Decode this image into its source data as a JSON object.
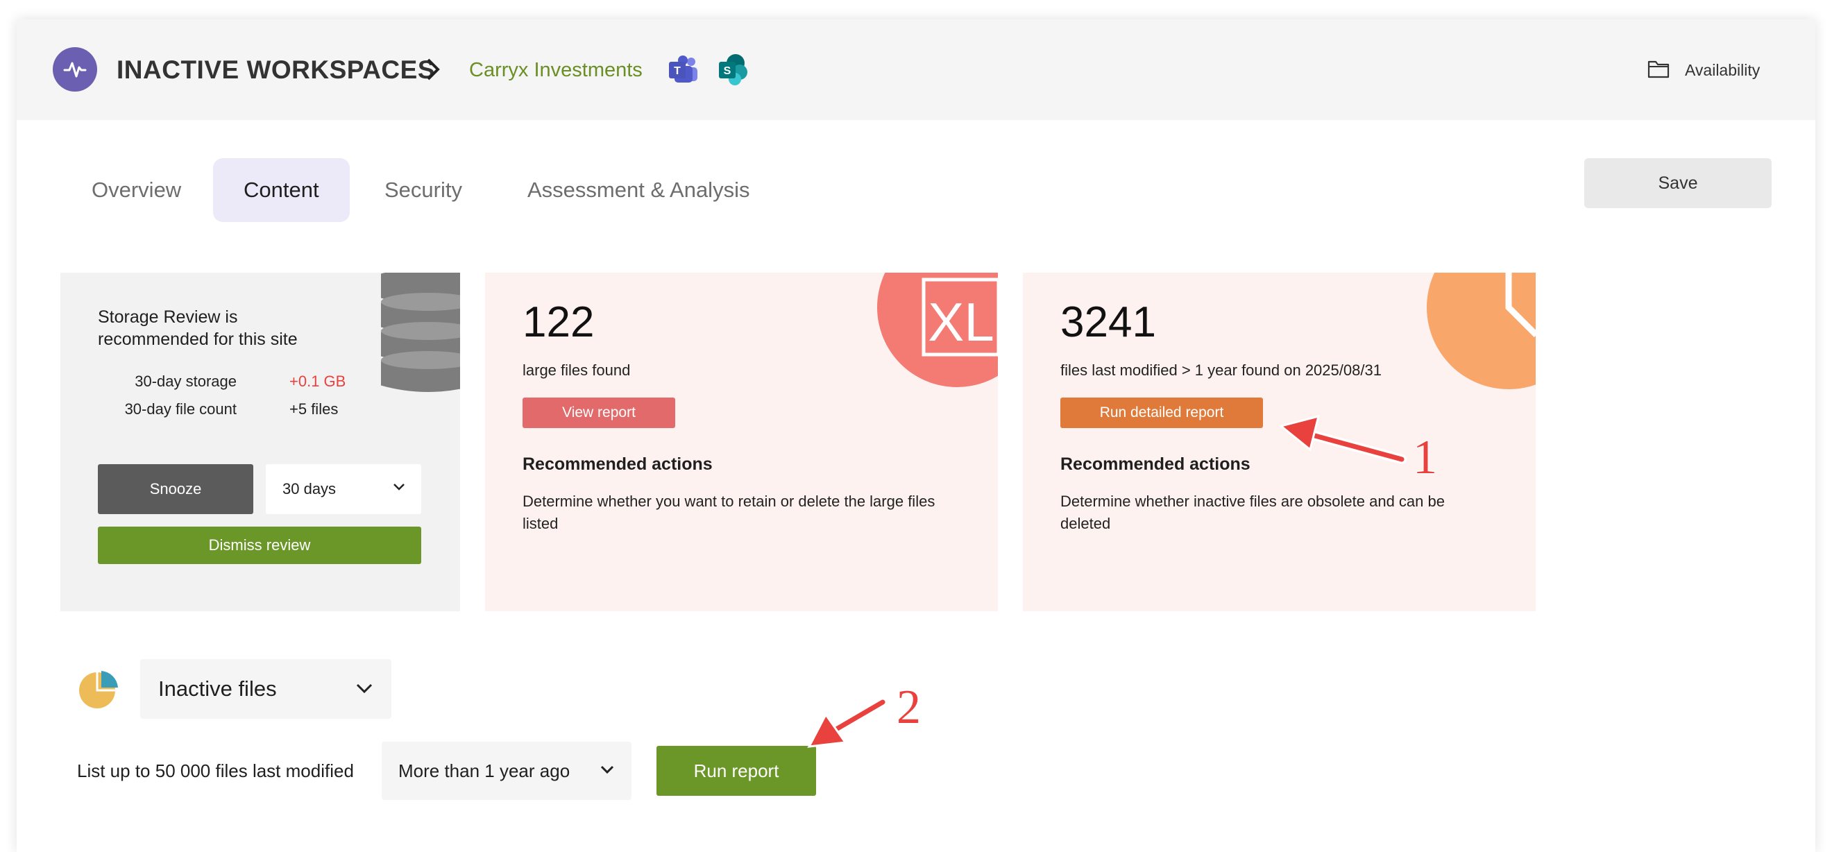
{
  "header": {
    "title": "INACTIVE WORKSPACES",
    "site_name": "Carryx Investments",
    "availability_label": "Availability"
  },
  "tabs": [
    {
      "label": "Overview",
      "active": false
    },
    {
      "label": "Content",
      "active": true
    },
    {
      "label": "Security",
      "active": false
    },
    {
      "label": "Assessment & Analysis",
      "active": false
    }
  ],
  "save_label": "Save",
  "storage_card": {
    "title": "Storage Review is recommended for this site",
    "storage_label": "30-day storage",
    "storage_value": "+0.1 GB",
    "filecount_label": "30-day file count",
    "filecount_value": "+5 files",
    "snooze_label": "Snooze",
    "snooze_duration": "30 days",
    "dismiss_label": "Dismiss review"
  },
  "large_files_card": {
    "count": "122",
    "description": "large files found",
    "button_label": "View report",
    "rec_title": "Recommended actions",
    "rec_text": "Determine whether you want to retain or delete the large files listed",
    "icon_text": "XL"
  },
  "inactive_card": {
    "count": "3241",
    "description": "files last modified > 1 year found on 2025/08/31",
    "button_label": "Run detailed report",
    "rec_title": "Recommended actions",
    "rec_text": "Determine whether inactive files are obsolete and can be deleted"
  },
  "report_section": {
    "report_type": "Inactive files",
    "list_label": "List up to 50 000 files last modified",
    "age_option": "More than 1 year ago",
    "run_label": "Run report"
  },
  "annotations": {
    "label_1": "1",
    "label_2": "2"
  },
  "colors": {
    "accent_green": "#6b9628",
    "logo_purple": "#6a5fb0",
    "view_report_red": "#e36a6a",
    "detailed_orange": "#e07a3a",
    "annotation_red": "#e8413e"
  }
}
